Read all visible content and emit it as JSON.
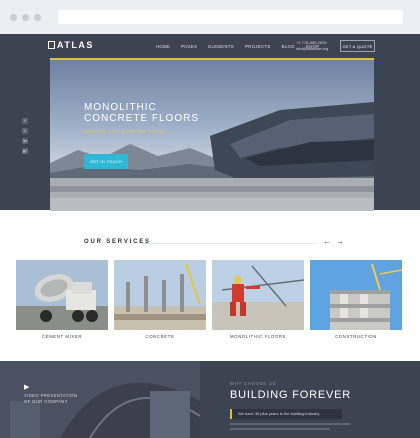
{
  "site": {
    "logo": "ATLAS",
    "nav": [
      "HOME",
      "PAGES",
      "ELEMENTS",
      "PROJECTS",
      "BLOG",
      "SHOP"
    ],
    "phone": "+1 778-865-2639",
    "email": "info@atlassite.org",
    "quote_label": "GET A QUOTE"
  },
  "social": [
    "f",
    "t",
    "in",
    "g+"
  ],
  "hero": {
    "title_line1": "MONOLITHIC",
    "title_line2": "CONCRETE FLOORS",
    "subtitle": "SERVING LIFE OVER 500 YEARS",
    "button": "GET IN TOUCH"
  },
  "services": {
    "title": "OUR SERVICES",
    "prev_icon": "arrow-left-icon",
    "next_icon": "arrow-right-icon",
    "items": [
      {
        "label": "CEMENT MIXER"
      },
      {
        "label": "CONCRETE"
      },
      {
        "label": "MONOLITHIC FLOORS"
      },
      {
        "label": "CONSTRUCTION"
      }
    ]
  },
  "footer": {
    "video_line1": "VIDEO PRESENTATION",
    "video_line2": "OF OUR COMPANY",
    "why": "WHY CHOOSE US",
    "heading": "BUILDING FOREVER",
    "bar": "We have 30 plus years in the building industry"
  }
}
